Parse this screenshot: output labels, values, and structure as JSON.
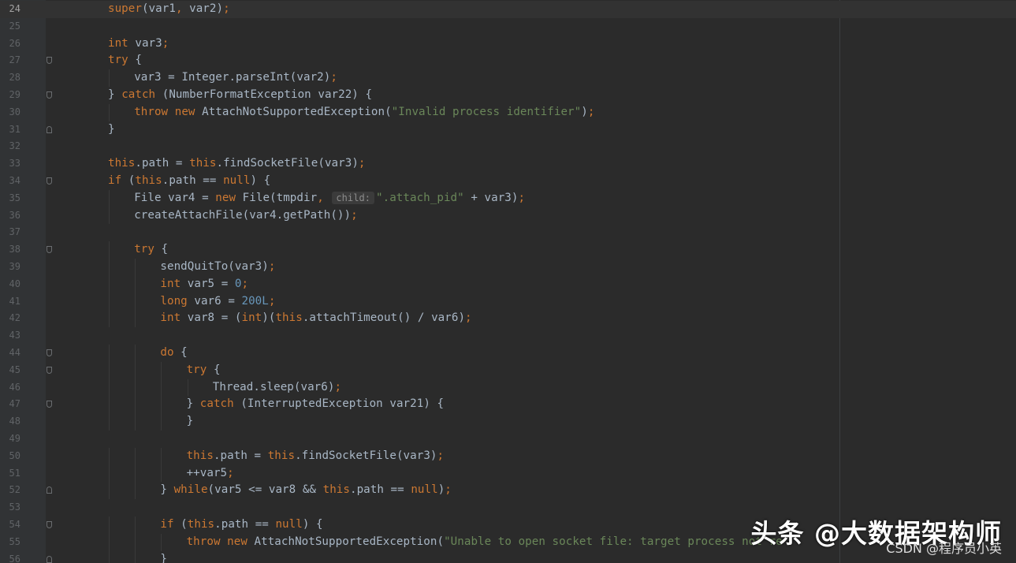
{
  "editor": {
    "current_line": 24,
    "lines": [
      {
        "n": "24",
        "indent": 0,
        "fold": "",
        "tokens": [
          [
            "kw",
            "super"
          ],
          [
            "",
            "(var1"
          ],
          [
            "kw",
            ","
          ],
          [
            "",
            " var2)"
          ],
          [
            "kw",
            ";"
          ]
        ]
      },
      {
        "n": "25",
        "indent": 0,
        "fold": "",
        "tokens": []
      },
      {
        "n": "26",
        "indent": 0,
        "fold": "",
        "tokens": [
          [
            "kw",
            "int"
          ],
          [
            "",
            " var3"
          ],
          [
            "kw",
            ";"
          ]
        ]
      },
      {
        "n": "27",
        "indent": 0,
        "fold": "start",
        "tokens": [
          [
            "kw",
            "try"
          ],
          [
            "",
            " {"
          ]
        ]
      },
      {
        "n": "28",
        "indent": 1,
        "fold": "",
        "tokens": [
          [
            "",
            "var3 = Integer.parseInt(var2)"
          ],
          [
            "kw",
            ";"
          ]
        ]
      },
      {
        "n": "29",
        "indent": 0,
        "fold": "mid",
        "tokens": [
          [
            "",
            "} "
          ],
          [
            "kw",
            "catch"
          ],
          [
            "",
            " (NumberFormatException var22) {"
          ]
        ]
      },
      {
        "n": "30",
        "indent": 1,
        "fold": "",
        "tokens": [
          [
            "kw",
            "throw new"
          ],
          [
            "",
            " AttachNotSupportedException("
          ],
          [
            "str",
            "\"Invalid process identifier\""
          ],
          [
            "",
            ")"
          ],
          [
            "kw",
            ";"
          ]
        ]
      },
      {
        "n": "31",
        "indent": 0,
        "fold": "end",
        "tokens": [
          [
            "",
            "}"
          ]
        ]
      },
      {
        "n": "32",
        "indent": 0,
        "fold": "",
        "tokens": []
      },
      {
        "n": "33",
        "indent": 0,
        "fold": "",
        "tokens": [
          [
            "kw",
            "this"
          ],
          [
            "",
            ".path = "
          ],
          [
            "kw",
            "this"
          ],
          [
            "",
            ".findSocketFile(var3)"
          ],
          [
            "kw",
            ";"
          ]
        ]
      },
      {
        "n": "34",
        "indent": 0,
        "fold": "start",
        "tokens": [
          [
            "kw",
            "if"
          ],
          [
            "",
            " ("
          ],
          [
            "kw",
            "this"
          ],
          [
            "",
            ".path == "
          ],
          [
            "kw",
            "null"
          ],
          [
            "",
            ") {"
          ]
        ]
      },
      {
        "n": "35",
        "indent": 1,
        "fold": "",
        "tokens": [
          [
            "",
            "File var4 = "
          ],
          [
            "kw",
            "new"
          ],
          [
            "",
            " File(tmpdir"
          ],
          [
            "kw",
            ","
          ],
          [
            "",
            " "
          ],
          [
            "hint",
            "child:"
          ],
          [
            "str",
            "\".attach_pid\""
          ],
          [
            "",
            " + var3)"
          ],
          [
            "kw",
            ";"
          ]
        ]
      },
      {
        "n": "36",
        "indent": 1,
        "fold": "",
        "tokens": [
          [
            "",
            "createAttachFile(var4.getPath())"
          ],
          [
            "kw",
            ";"
          ]
        ]
      },
      {
        "n": "37",
        "indent": 0,
        "fold": "",
        "tokens": []
      },
      {
        "n": "38",
        "indent": 1,
        "fold": "start",
        "tokens": [
          [
            "kw",
            "try"
          ],
          [
            "",
            " {"
          ]
        ]
      },
      {
        "n": "39",
        "indent": 2,
        "fold": "",
        "tokens": [
          [
            "",
            "sendQuitTo(var3)"
          ],
          [
            "kw",
            ";"
          ]
        ]
      },
      {
        "n": "40",
        "indent": 2,
        "fold": "",
        "tokens": [
          [
            "kw",
            "int"
          ],
          [
            "",
            " var5 = "
          ],
          [
            "num",
            "0"
          ],
          [
            "kw",
            ";"
          ]
        ]
      },
      {
        "n": "41",
        "indent": 2,
        "fold": "",
        "tokens": [
          [
            "kw",
            "long"
          ],
          [
            "",
            " var6 = "
          ],
          [
            "num",
            "200L"
          ],
          [
            "kw",
            ";"
          ]
        ]
      },
      {
        "n": "42",
        "indent": 2,
        "fold": "",
        "tokens": [
          [
            "kw",
            "int"
          ],
          [
            "",
            " var8 = ("
          ],
          [
            "kw",
            "int"
          ],
          [
            "",
            ")("
          ],
          [
            "kw",
            "this"
          ],
          [
            "",
            ".attachTimeout() / var6)"
          ],
          [
            "kw",
            ";"
          ]
        ]
      },
      {
        "n": "43",
        "indent": 0,
        "fold": "",
        "tokens": []
      },
      {
        "n": "44",
        "indent": 2,
        "fold": "start",
        "tokens": [
          [
            "kw",
            "do"
          ],
          [
            "",
            " {"
          ]
        ]
      },
      {
        "n": "45",
        "indent": 3,
        "fold": "start",
        "tokens": [
          [
            "kw",
            "try"
          ],
          [
            "",
            " {"
          ]
        ]
      },
      {
        "n": "46",
        "indent": 4,
        "fold": "",
        "tokens": [
          [
            "",
            "Thread.sleep(var6)"
          ],
          [
            "kw",
            ";"
          ]
        ]
      },
      {
        "n": "47",
        "indent": 3,
        "fold": "mid",
        "tokens": [
          [
            "",
            "} "
          ],
          [
            "kw",
            "catch"
          ],
          [
            "",
            " (InterruptedException var21) {"
          ]
        ]
      },
      {
        "n": "48",
        "indent": 3,
        "fold": "",
        "tokens": [
          [
            "",
            "}"
          ]
        ]
      },
      {
        "n": "49",
        "indent": 0,
        "fold": "",
        "tokens": []
      },
      {
        "n": "50",
        "indent": 3,
        "fold": "",
        "tokens": [
          [
            "kw",
            "this"
          ],
          [
            "",
            ".path = "
          ],
          [
            "kw",
            "this"
          ],
          [
            "",
            ".findSocketFile(var3)"
          ],
          [
            "kw",
            ";"
          ]
        ]
      },
      {
        "n": "51",
        "indent": 3,
        "fold": "",
        "tokens": [
          [
            "",
            "++var5"
          ],
          [
            "kw",
            ";"
          ]
        ]
      },
      {
        "n": "52",
        "indent": 2,
        "fold": "end",
        "tokens": [
          [
            "",
            "} "
          ],
          [
            "kw",
            "while"
          ],
          [
            "",
            "(var5 <= var8 && "
          ],
          [
            "kw",
            "this"
          ],
          [
            "",
            ".path == "
          ],
          [
            "kw",
            "null"
          ],
          [
            "",
            ")"
          ],
          [
            "kw",
            ";"
          ]
        ]
      },
      {
        "n": "53",
        "indent": 0,
        "fold": "",
        "tokens": []
      },
      {
        "n": "54",
        "indent": 2,
        "fold": "start",
        "tokens": [
          [
            "kw",
            "if"
          ],
          [
            "",
            " ("
          ],
          [
            "kw",
            "this"
          ],
          [
            "",
            ".path == "
          ],
          [
            "kw",
            "null"
          ],
          [
            "",
            ") {"
          ]
        ]
      },
      {
        "n": "55",
        "indent": 3,
        "fold": "",
        "tokens": [
          [
            "kw",
            "throw new"
          ],
          [
            "",
            " AttachNotSupportedException("
          ],
          [
            "str",
            "\"Unable to open socket file: target process not re"
          ]
        ]
      },
      {
        "n": "56",
        "indent": 2,
        "fold": "end",
        "tokens": [
          [
            "",
            "}"
          ]
        ]
      }
    ]
  },
  "watermark": {
    "main": "头条 @大数据架构师",
    "sub": "CSDN @程序员小英"
  }
}
